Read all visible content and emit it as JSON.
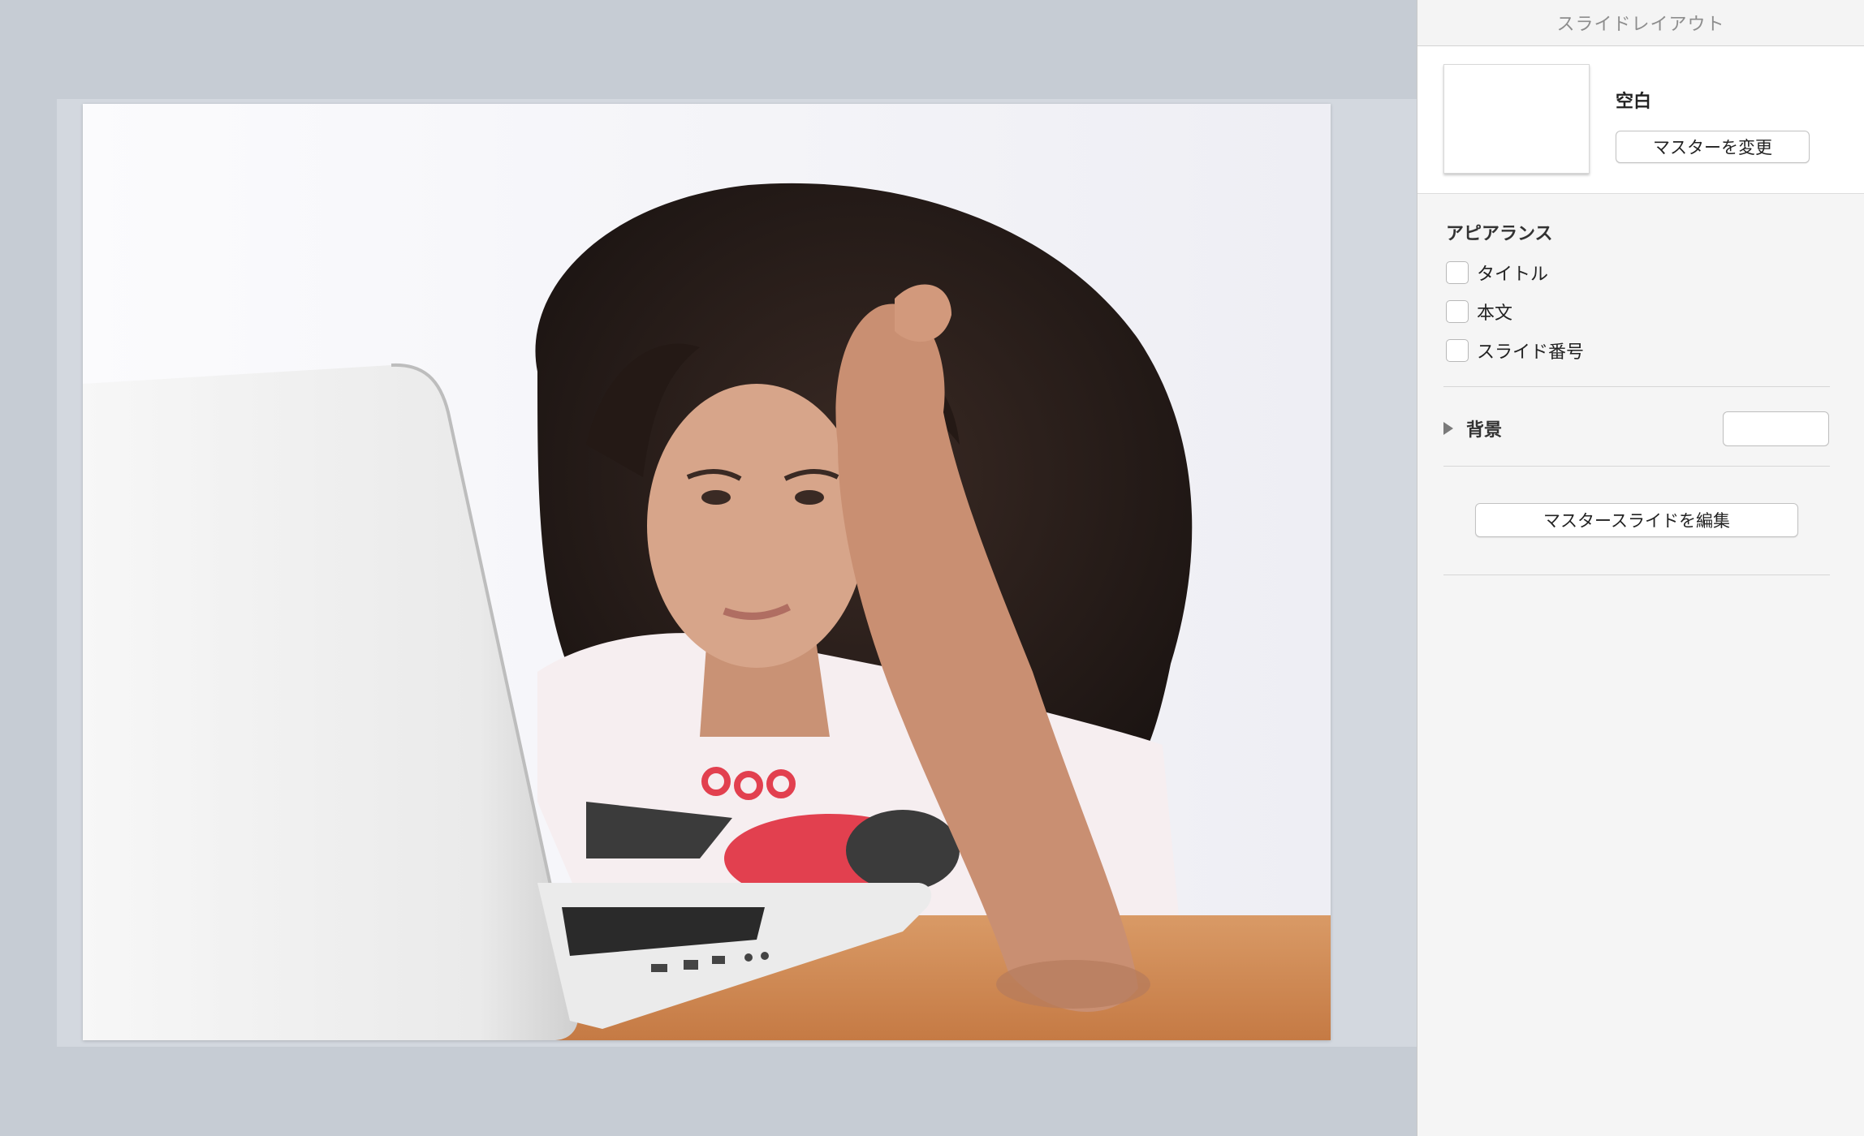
{
  "inspector": {
    "title": "スライドレイアウト",
    "layout_name": "空白",
    "change_master_label": "マスターを変更",
    "appearance_heading": "アピアランス",
    "options": [
      {
        "label": "タイトル",
        "checked": false
      },
      {
        "label": "本文",
        "checked": false
      },
      {
        "label": "スライド番号",
        "checked": false
      }
    ],
    "background_label": "背景",
    "background_color": "#ffffff",
    "edit_master_label": "マスタースライドを編集"
  },
  "slide": {
    "image_subject": "woman-at-laptop-photo"
  },
  "colors": {
    "canvas": "#c6ccd4",
    "panel": "#f5f5f5"
  }
}
